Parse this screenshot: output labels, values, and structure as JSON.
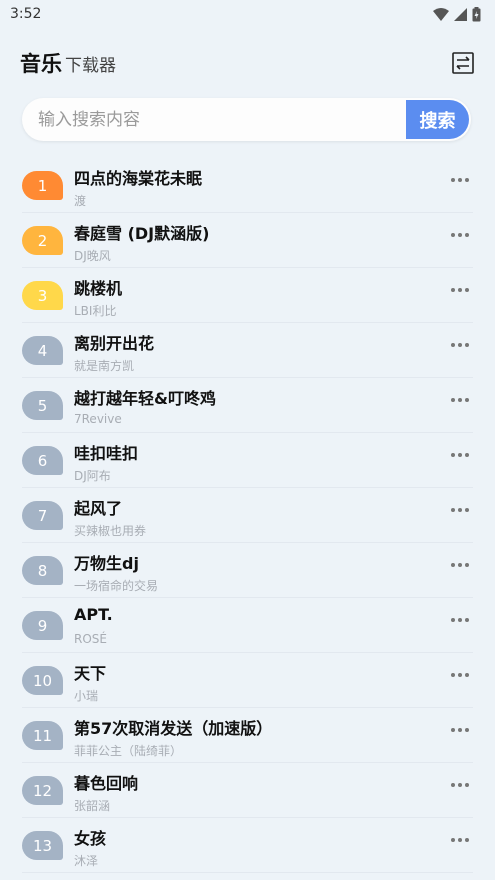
{
  "status_bar": {
    "time": "3:52"
  },
  "header": {
    "title": "音乐",
    "subtitle": "下载器"
  },
  "search": {
    "placeholder": "输入搜索内容",
    "button_label": "搜索"
  },
  "colors": {
    "accent": "#5b8df0",
    "rank_1": "#ff8a33",
    "rank_2": "#ffb53e",
    "rank_3": "#ffd84a",
    "rank_default": "#a4b3c5"
  },
  "songs": [
    {
      "rank": "1",
      "title": "四点的海棠花未眠",
      "artist": "渡"
    },
    {
      "rank": "2",
      "title": "春庭雪 (DJ默涵版)",
      "artist": "DJ晚风"
    },
    {
      "rank": "3",
      "title": "跳楼机",
      "artist": "LBI利比"
    },
    {
      "rank": "4",
      "title": "离别开出花",
      "artist": "就是南方凯"
    },
    {
      "rank": "5",
      "title": "越打越年轻&叮咚鸡",
      "artist": "7Revive"
    },
    {
      "rank": "6",
      "title": "哇扣哇扣",
      "artist": "DJ阿布"
    },
    {
      "rank": "7",
      "title": "起风了",
      "artist": "买辣椒也用券"
    },
    {
      "rank": "8",
      "title": "万物生dj",
      "artist": "一场宿命的交易"
    },
    {
      "rank": "9",
      "title": "APT.",
      "artist": "ROSÉ"
    },
    {
      "rank": "10",
      "title": "天下",
      "artist": "小瑞"
    },
    {
      "rank": "11",
      "title": "第57次取消发送（加速版）",
      "artist": "菲菲公主（陆绮菲）"
    },
    {
      "rank": "12",
      "title": "暮色回响",
      "artist": "张韶涵"
    },
    {
      "rank": "13",
      "title": "女孩",
      "artist": "沐泽"
    }
  ]
}
